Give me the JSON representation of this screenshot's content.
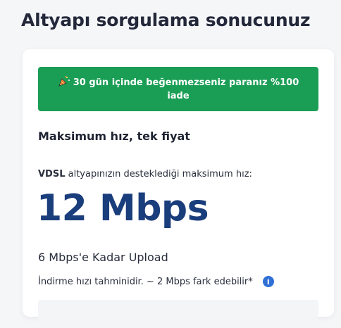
{
  "page": {
    "title": "Altyapı sorgulama sonucunuz"
  },
  "banner": {
    "text": "30 gün içinde beğenmezseniz paranız %100 iade",
    "icon": "party-popper-icon",
    "color": "#1a9e55"
  },
  "section": {
    "title": "Maksimum hız, tek fiyat"
  },
  "speed": {
    "tech": "VDSL",
    "desc": " altyapınızın desteklediği maksimum hız:",
    "value": "12 Mbps",
    "color": "#1a3d7c"
  },
  "upload": {
    "text": "6 Mbps'e Kadar Upload"
  },
  "note": {
    "text": "İndirme hızı tahminidir. ~ 2 Mbps fark edebilir*",
    "icon": "info-icon",
    "icon_glyph": "i"
  }
}
